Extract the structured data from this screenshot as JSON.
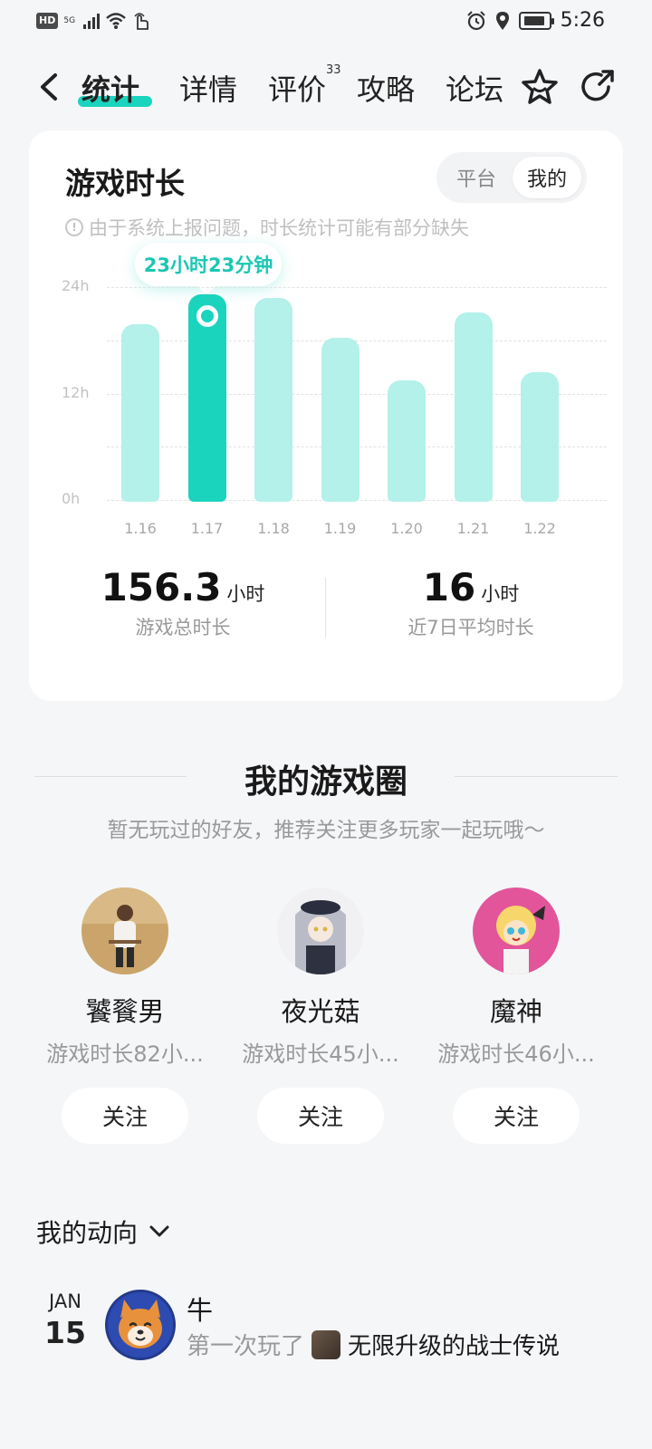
{
  "status_bar": {
    "hd": "HD",
    "network": "5G",
    "time": "5:26"
  },
  "nav": {
    "tabs": [
      {
        "label": "统计",
        "active": true
      },
      {
        "label": "详情",
        "active": false
      },
      {
        "label": "评价",
        "active": false,
        "badge": "33"
      },
      {
        "label": "攻略",
        "active": false
      },
      {
        "label": "论坛",
        "active": false
      }
    ],
    "icons": [
      "back-arrow-icon",
      "star-icon",
      "share-icon"
    ],
    "accent": "#1ad4bd"
  },
  "stats_card": {
    "title": "游戏时长",
    "toggle": {
      "options": [
        "平台",
        "我的"
      ],
      "selected": "我的"
    },
    "notice": "由于系统上报问题，时长统计可能有部分缺失",
    "tooltip": "23小时23分钟",
    "total": {
      "value": "156.3",
      "unit": "小时",
      "label": "游戏总时长"
    },
    "average": {
      "value": "16",
      "unit": "小时",
      "label": "近7日平均时长"
    }
  },
  "chart_data": {
    "type": "bar",
    "categories": [
      "1.16",
      "1.17",
      "1.18",
      "1.19",
      "1.20",
      "1.21",
      "1.22"
    ],
    "values": [
      20,
      23.4,
      23,
      18.5,
      13.7,
      21.3,
      14.6
    ],
    "selected_index": 1,
    "y_ticks": [
      "0h",
      "12h",
      "24h"
    ],
    "ylim": [
      0,
      24
    ],
    "grid": true,
    "colors": {
      "bar": "#b3f1ea",
      "selected": "#1ad4bd"
    }
  },
  "game_circle": {
    "title": "我的游戏圈",
    "subtitle": "暂无玩过的好友，推荐关注更多玩家一起玩哦～",
    "friends": [
      {
        "name": "饕餮男",
        "meta": "游戏时长82小...",
        "button": "关注"
      },
      {
        "name": "夜光菇",
        "meta": "游戏时长45小...",
        "button": "关注"
      },
      {
        "name": "魔神",
        "meta": "游戏时长46小...",
        "button": "关注"
      }
    ]
  },
  "activity": {
    "header": "我的动向",
    "items": [
      {
        "month": "JAN",
        "day": "15",
        "user": "牛",
        "prefix": "第一次玩了",
        "game": "无限升级的战士传说"
      }
    ]
  }
}
